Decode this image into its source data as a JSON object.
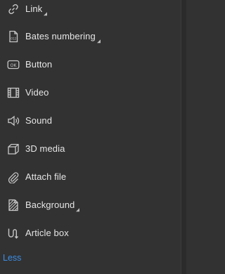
{
  "menu": {
    "items": [
      {
        "label": "Link",
        "icon": "link-icon",
        "has_submenu": true
      },
      {
        "label": "Bates numbering",
        "icon": "bates-numbering-icon",
        "has_submenu": true
      },
      {
        "label": "Button",
        "icon": "ok-button-icon",
        "has_submenu": false
      },
      {
        "label": "Video",
        "icon": "film-icon",
        "has_submenu": false
      },
      {
        "label": "Sound",
        "icon": "speaker-icon",
        "has_submenu": false
      },
      {
        "label": "3D media",
        "icon": "cube-icon",
        "has_submenu": false
      },
      {
        "label": "Attach file",
        "icon": "paperclip-icon",
        "has_submenu": false
      },
      {
        "label": "Background",
        "icon": "background-icon",
        "has_submenu": true
      },
      {
        "label": "Article box",
        "icon": "article-box-icon",
        "has_submenu": false
      }
    ],
    "less_label": "Less",
    "link_color": "#3b8ee6"
  }
}
